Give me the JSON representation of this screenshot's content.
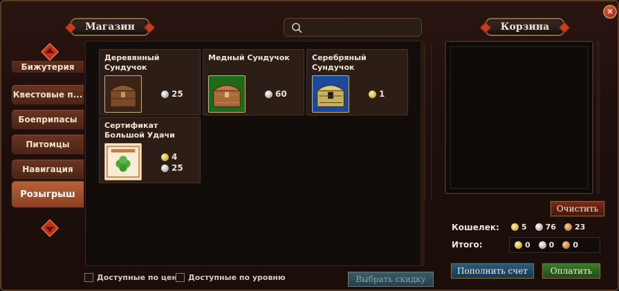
{
  "header": {
    "shop_title": "Магазин",
    "cart_title": "Корзина",
    "search_placeholder": ""
  },
  "categories": [
    {
      "label": "Бижутерия",
      "active": false
    },
    {
      "label": "Квестовые п...",
      "active": false
    },
    {
      "label": "Боеприпасы",
      "active": false
    },
    {
      "label": "Питомцы",
      "active": false
    },
    {
      "label": "Навигация",
      "active": false
    },
    {
      "label": "Розыгрыш",
      "active": true
    }
  ],
  "products": [
    {
      "name": "Деревянный Сундучок",
      "icon": "wooden-chest-icon",
      "frame": "#6a4a30",
      "prices": [
        {
          "currency": "silver",
          "amount": "25"
        }
      ]
    },
    {
      "name": "Медный Сундучок",
      "icon": "copper-chest-icon",
      "frame": "#2a8a24",
      "prices": [
        {
          "currency": "silver",
          "amount": "60"
        }
      ]
    },
    {
      "name": "Серебряный Сундучок",
      "icon": "silver-chest-icon",
      "frame": "#1c5ab8",
      "prices": [
        {
          "currency": "gold",
          "amount": "1"
        }
      ]
    },
    {
      "name": "Сертификат Большой Удачи",
      "icon": "luck-certificate-icon",
      "frame": "#d88a5a",
      "prices": [
        {
          "currency": "gold",
          "amount": "4"
        },
        {
          "currency": "silver",
          "amount": "25"
        }
      ]
    }
  ],
  "filters": {
    "by_price": "Доступные по цене",
    "by_level": "Доступные по уровню",
    "discount_button": "Выбрать скидку"
  },
  "cart": {
    "clear_button": "Очистить",
    "wallet_label": "Кошелек:",
    "total_label": "Итого:",
    "wallet": {
      "gold": "5",
      "silver": "76",
      "bronze": "23"
    },
    "total": {
      "gold": "0",
      "silver": "0",
      "bronze": "0"
    },
    "topup_button": "Пополнить счет",
    "pay_button": "Оплатить"
  },
  "colors": {
    "gold": "#e0b020",
    "silver": "#c8c8cc",
    "bronze": "#d07a2a",
    "accent": "#c0401e"
  }
}
